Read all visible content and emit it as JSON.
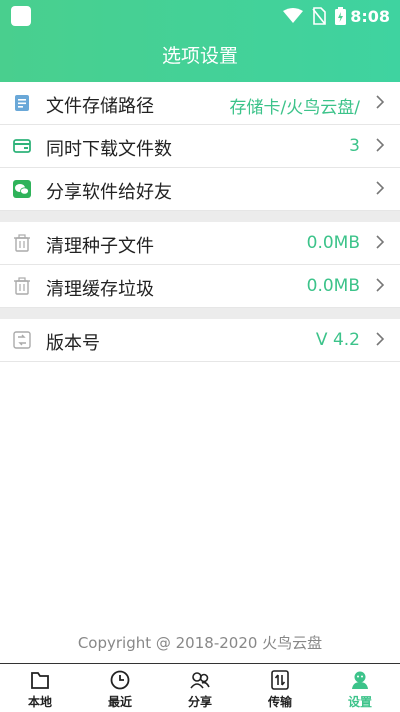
{
  "status_bar": {
    "time": "8:08"
  },
  "header": {
    "title": "选项设置"
  },
  "settings": {
    "group1": [
      {
        "label": "文件存储路径",
        "value": "存储卡/火鸟云盘/",
        "icon": "document-icon"
      },
      {
        "label": "同时下载文件数",
        "value": "3",
        "icon": "wallet-icon"
      },
      {
        "label": "分享软件给好友",
        "value": "",
        "icon": "wechat-icon"
      }
    ],
    "group2": [
      {
        "label": "清理种子文件",
        "value": "0.0MB",
        "icon": "trash-icon"
      },
      {
        "label": "清理缓存垃圾",
        "value": "0.0MB",
        "icon": "trash-icon"
      }
    ],
    "group3": [
      {
        "label": "版本号",
        "value": "V 4.2",
        "icon": "version-icon"
      }
    ]
  },
  "footer": {
    "copyright": "Copyright @ 2018-2020 火鸟云盘"
  },
  "tabs": [
    {
      "label": "本地",
      "icon": "folder-icon",
      "active": false
    },
    {
      "label": "最近",
      "icon": "clock-icon",
      "active": false
    },
    {
      "label": "分享",
      "icon": "users-icon",
      "active": false
    },
    {
      "label": "传输",
      "icon": "transfer-icon",
      "active": false
    },
    {
      "label": "设置",
      "icon": "user-settings-icon",
      "active": true
    }
  ],
  "colors": {
    "accent": "#3cc38a",
    "header_start": "#49cf8e",
    "header_end": "#3fd3a0",
    "divider": "#ececec"
  }
}
